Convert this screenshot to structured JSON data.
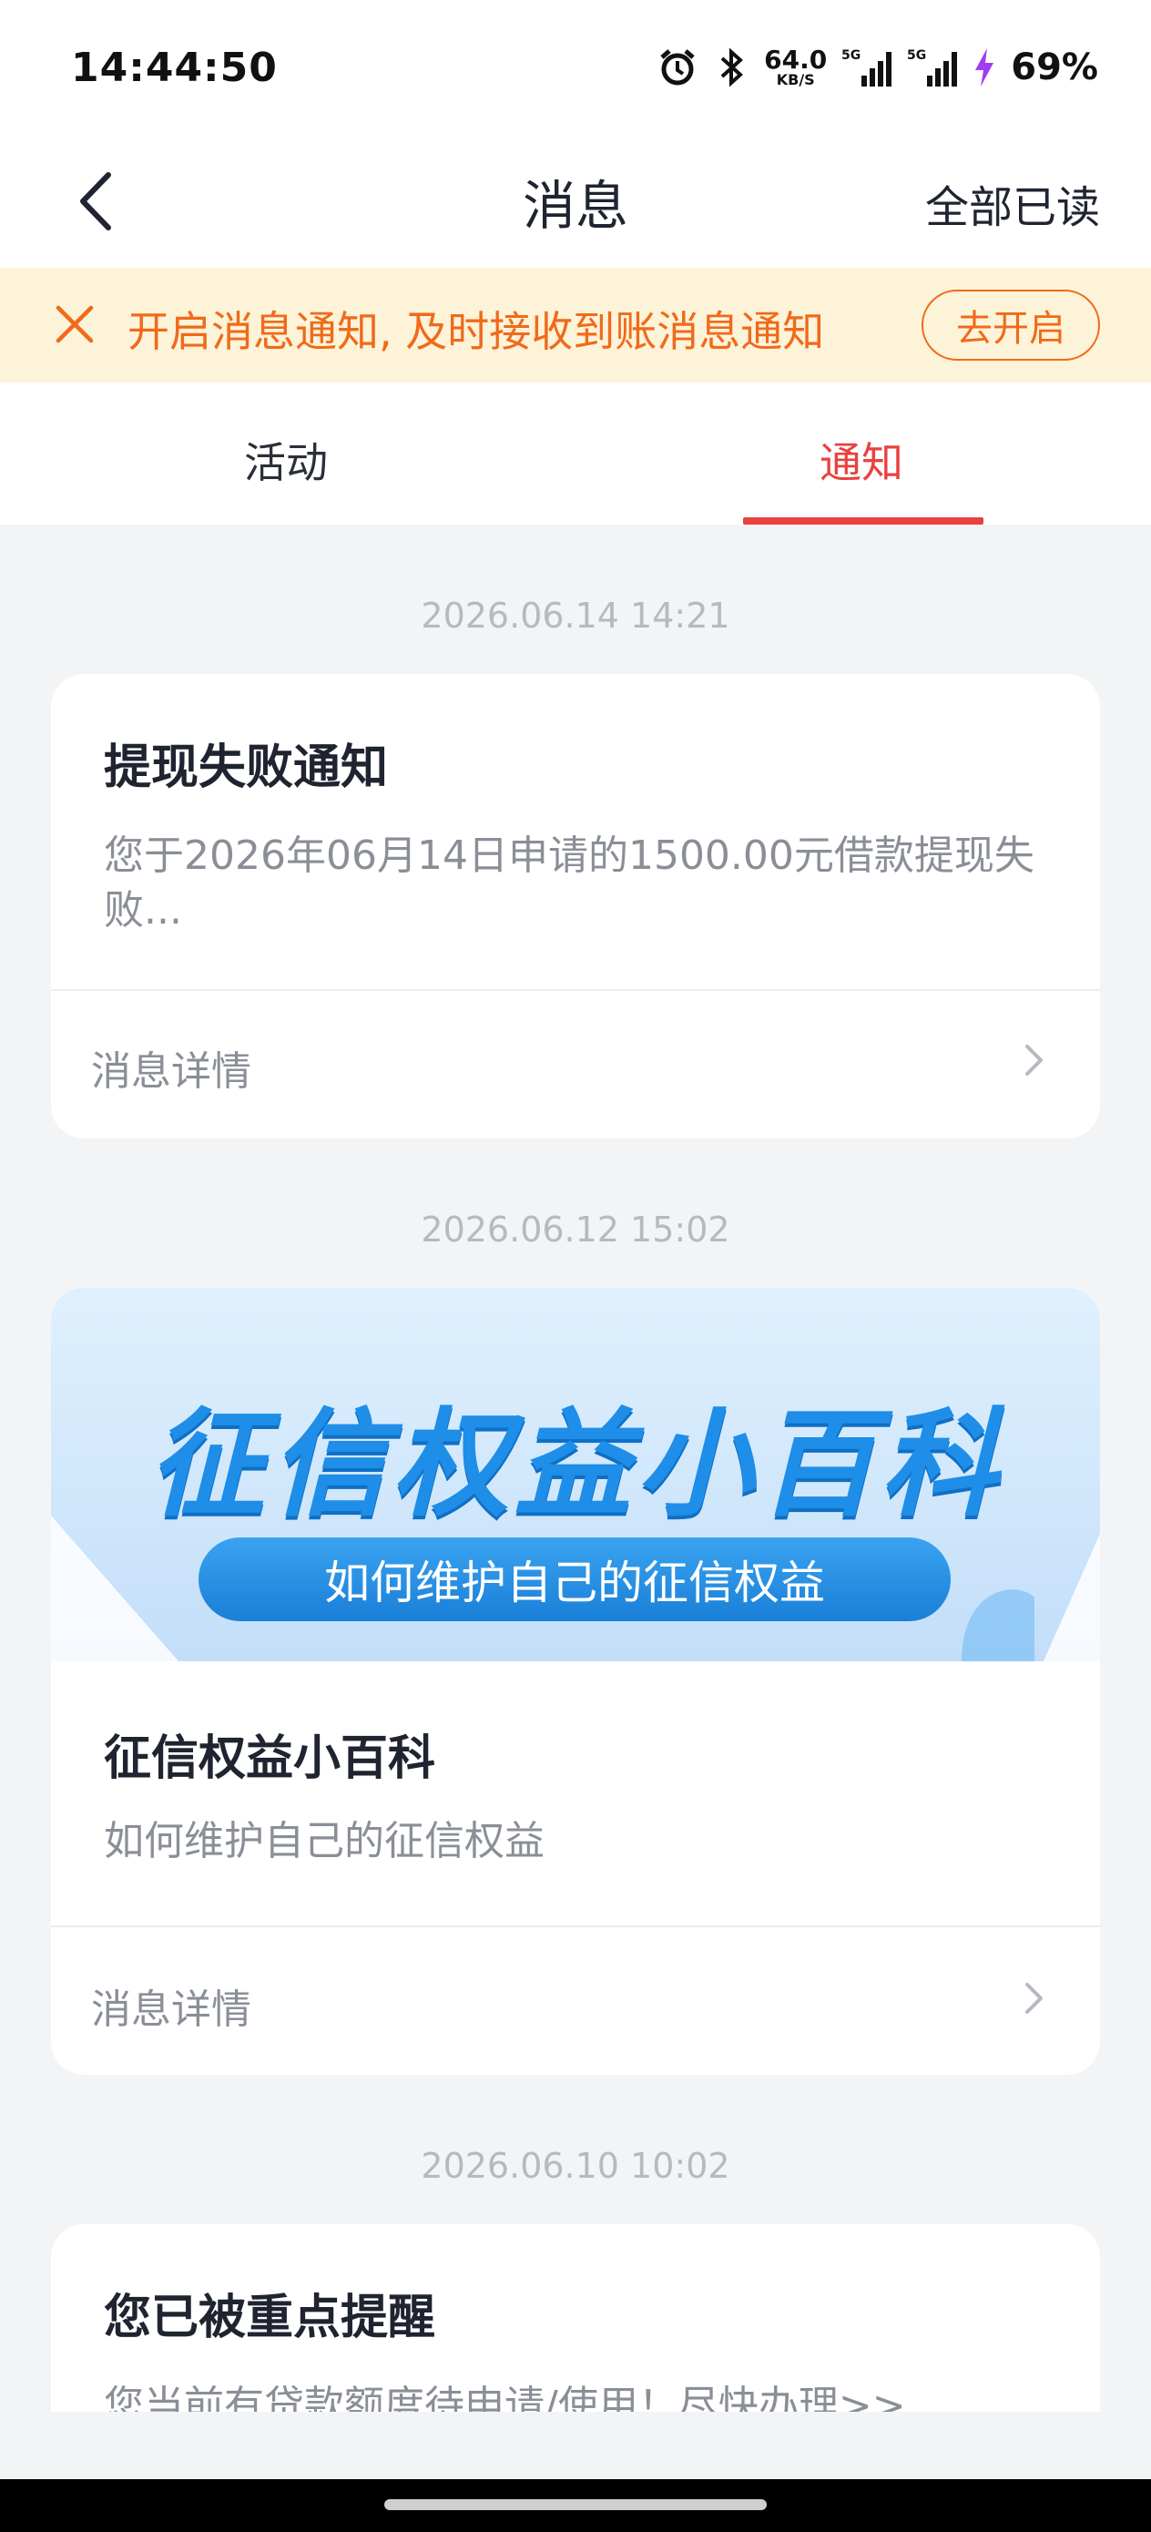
{
  "status_bar": {
    "time": "14:44:50",
    "net_speed_value": "64.0",
    "net_speed_unit": "KB/S",
    "signal_1_label": "5G",
    "signal_2_label": "5G",
    "battery_percent": "69%",
    "icons": [
      "alarm-icon",
      "bluetooth-icon",
      "signal-icon",
      "signal-icon",
      "charging-icon"
    ]
  },
  "header": {
    "title": "消息",
    "mark_all_read": "全部已读"
  },
  "notice_banner": {
    "text": "开启消息通知, 及时接收到账消息通知",
    "button": "去开启"
  },
  "tabs": [
    {
      "label": "活动",
      "active": false
    },
    {
      "label": "通知",
      "active": true
    }
  ],
  "accent_color": "#e8413f",
  "banner_color": "#f06a1a",
  "messages": [
    {
      "timestamp": "2026.06.14 14:21",
      "title": "提现失败通知",
      "body": "您于2026年06月14日申请的1500.00元借款提现失败...",
      "detail_label": "消息详情"
    },
    {
      "timestamp": "2026.06.12 15:02",
      "image_title": "征信权益小百科",
      "image_subtitle": "如何维护自己的征信权益",
      "title": "征信权益小百科",
      "body": "如何维护自己的征信权益",
      "detail_label": "消息详情"
    },
    {
      "timestamp": "2026.06.10 10:02",
      "title": "您已被重点提醒",
      "body": "您当前有贷款额度待申请/使用！尽快办理>>"
    }
  ]
}
